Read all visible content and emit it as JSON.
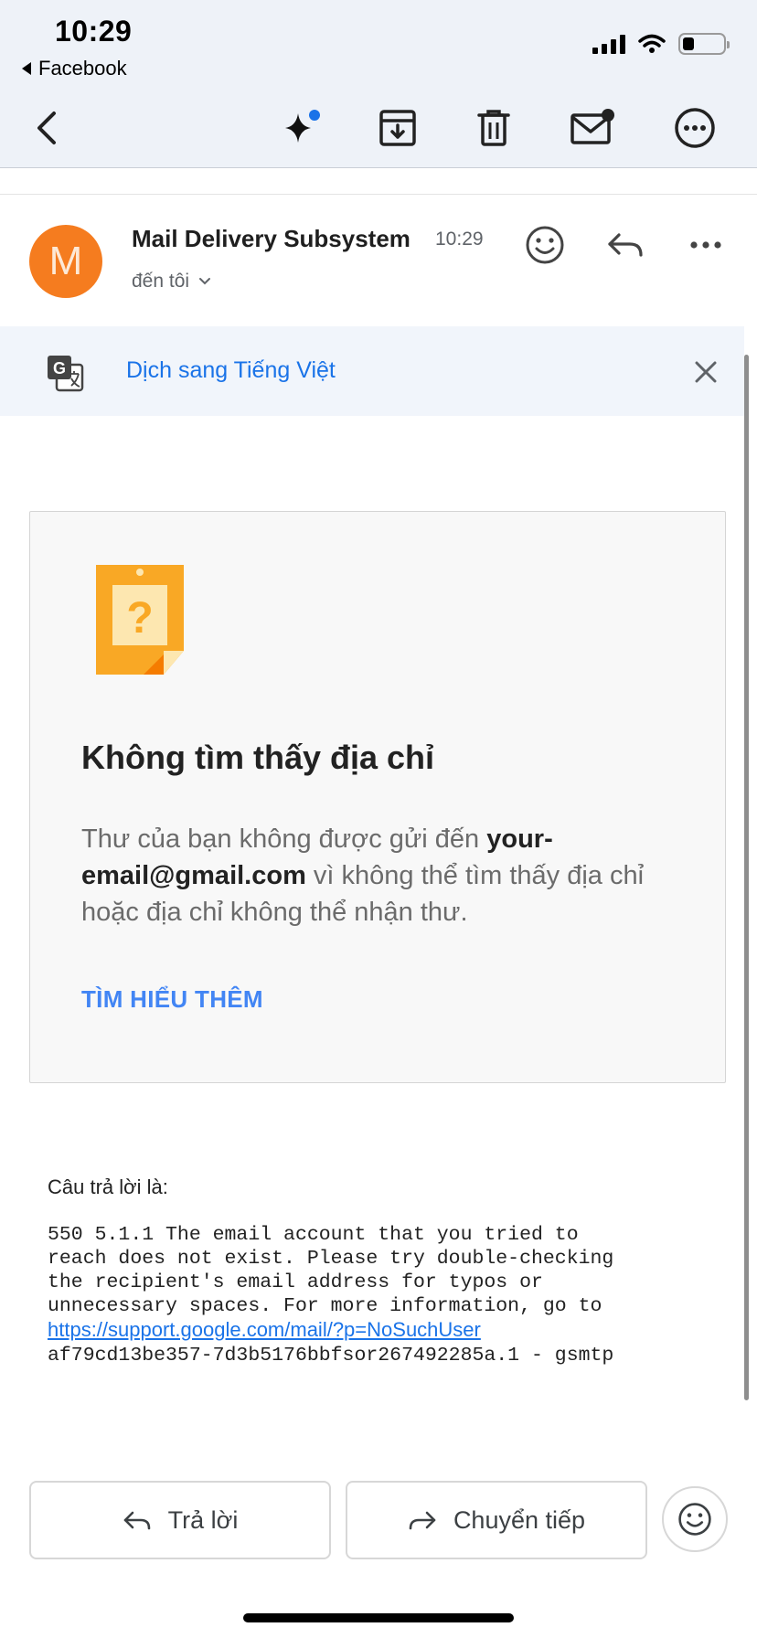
{
  "status_bar": {
    "time": "10:29",
    "back_app": "Facebook"
  },
  "toolbar": {
    "icons": [
      "back-chevron-icon",
      "sparkle-icon",
      "archive-icon",
      "trash-icon",
      "mark-unread-icon",
      "more-icon"
    ],
    "accent_color": "#1a73e8"
  },
  "message_header": {
    "avatar_letter": "M",
    "avatar_color": "#f57c1f",
    "sender": "Mail Delivery Subsystem",
    "time": "10:29",
    "recipient": "đến tôi"
  },
  "translate_bar": {
    "link": "Dịch sang Tiếng Việt"
  },
  "bounce_card": {
    "title": "Không tìm thấy địa chỉ",
    "body_prefix": "Thư của bạn không được gửi đến ",
    "email": "your-email@gmail.com",
    "body_suffix": " vì không thể tìm thấy địa chỉ hoặc địa chỉ không thể nhận thư.",
    "link": "TÌM HIỂU THÊM"
  },
  "response": {
    "label": "Câu trả lời là:",
    "lines": [
      "550 5.1.1 The email account that you tried to",
      "reach does not exist. Please try double-checking",
      "the recipient's email address for typos or",
      "unnecessary spaces. For more information, go to"
    ],
    "url": "https://support.google.com/mail/?p=NoSuchUser",
    "trailer": "af79cd13be357-7d3b5176bbfsor267492285a.1 - gsmtp"
  },
  "actions": {
    "reply": "Trả lời",
    "forward": "Chuyển tiếp"
  }
}
